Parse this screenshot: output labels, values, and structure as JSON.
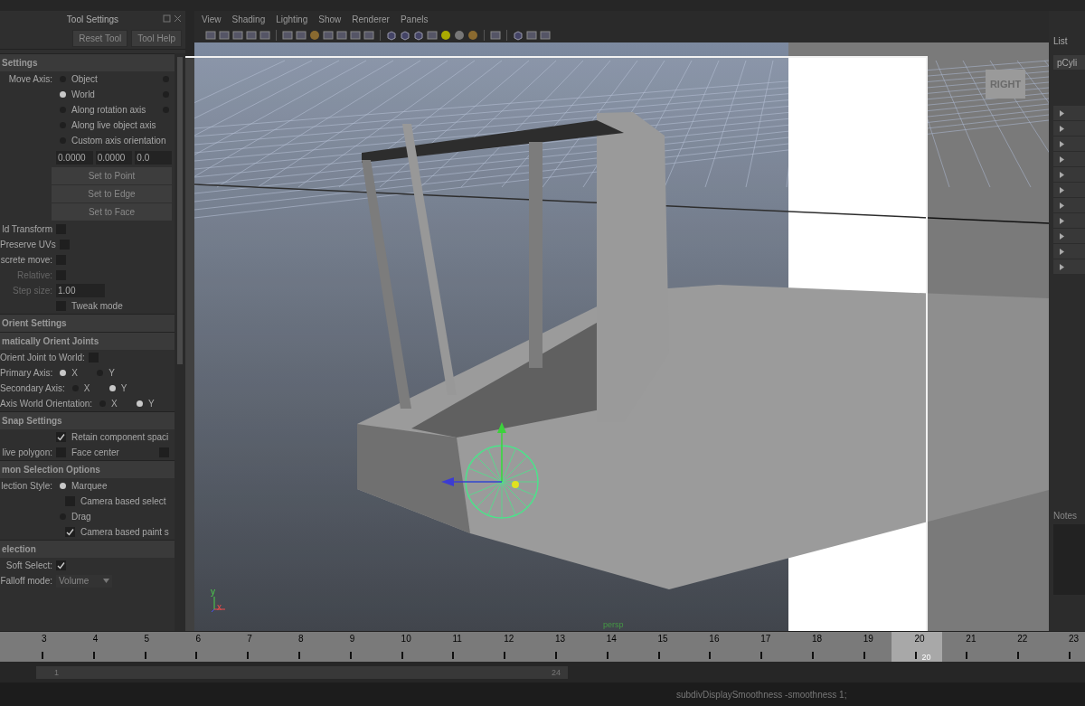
{
  "tool_settings": {
    "title": "Tool Settings",
    "buttons": [
      "Reset Tool",
      "Tool Help"
    ],
    "rows": [
      {
        "kind": "header",
        "text": "Settings"
      },
      {
        "kind": "radio",
        "label": "Move Axis:",
        "option": "Object",
        "selected": false,
        "second": {
          "selected": false
        }
      },
      {
        "kind": "radio",
        "option": "World",
        "selected": true,
        "second": {
          "selected": false
        }
      },
      {
        "kind": "radio",
        "option": "Along rotation axis",
        "selected": false,
        "second": {
          "selected": false
        }
      },
      {
        "kind": "radio",
        "option": "Along live object axis",
        "selected": false
      },
      {
        "kind": "radio",
        "option": "Custom axis orientation",
        "selected": false
      },
      {
        "kind": "fields",
        "values": [
          "0.0000",
          "0.0000",
          "0.0"
        ]
      },
      {
        "kind": "button",
        "text": "Set to Point"
      },
      {
        "kind": "button",
        "text": "Set to Edge"
      },
      {
        "kind": "button",
        "text": "Set to Face"
      },
      {
        "kind": "check",
        "label": "ld Transform",
        "checked": false,
        "disabled": false
      },
      {
        "kind": "check",
        "label": "Preserve UVs",
        "checked": false,
        "disabled": false
      },
      {
        "kind": "check",
        "label": "screte move:",
        "checked": false,
        "disabled": false
      },
      {
        "kind": "check",
        "label": "Relative:",
        "checked": false,
        "disabled": true
      },
      {
        "kind": "field",
        "label": "Step size:",
        "value": "1.00",
        "disabled": true
      },
      {
        "kind": "check",
        "option": "Tweak mode",
        "checked": false,
        "disabled": false
      },
      {
        "kind": "header",
        "text": "Orient Settings"
      },
      {
        "kind": "header",
        "text": "matically Orient Joints"
      },
      {
        "kind": "check",
        "label": "Orient Joint to World:",
        "checked": false,
        "disabled": false
      },
      {
        "kind": "axis",
        "label": "Primary Axis:",
        "options": [
          {
            "text": "X",
            "selected": true
          },
          {
            "text": "Y",
            "selected": false
          }
        ]
      },
      {
        "kind": "axis",
        "label": "Secondary Axis:",
        "options": [
          {
            "text": "X",
            "selected": false
          },
          {
            "text": "Y",
            "selected": true
          }
        ]
      },
      {
        "kind": "axis",
        "label": "Axis World Orientation:",
        "options": [
          {
            "text": "X",
            "selected": false
          },
          {
            "text": "Y",
            "selected": true
          }
        ]
      },
      {
        "kind": "header",
        "text": "Snap Settings"
      },
      {
        "kind": "check",
        "option": "Retain component spaci",
        "checked": true,
        "disabled": false
      },
      {
        "kind": "check",
        "label": "live polygon:",
        "option": "Face center",
        "checked": false,
        "disabled": false,
        "second": {
          "checked": false
        }
      },
      {
        "kind": "header",
        "text": "mon Selection Options"
      },
      {
        "kind": "radio",
        "label": "lection Style:",
        "option": "Marquee",
        "selected": true
      },
      {
        "kind": "subcheck",
        "option": "Camera based select",
        "checked": false
      },
      {
        "kind": "radio",
        "option": "Drag",
        "selected": false
      },
      {
        "kind": "subcheck",
        "option": "Camera based paint s",
        "checked": true
      },
      {
        "kind": "header",
        "text": "election"
      },
      {
        "kind": "check",
        "label": "Soft Select:",
        "checked": true,
        "disabled": false
      },
      {
        "kind": "dropdown",
        "label": "Falloff mode:",
        "value": "Volume"
      }
    ]
  },
  "viewport": {
    "menus": [
      "View",
      "Shading",
      "Lighting",
      "Show",
      "Renderer",
      "Panels"
    ],
    "view_cube": "RIGHT",
    "axis_labels": [
      "y",
      "x"
    ],
    "camera": "persp"
  },
  "right_panel": {
    "title": "List",
    "field": "pCyli",
    "frames": [
      {
        "expanded": false
      },
      {
        "expanded": false
      },
      {
        "expanded": false
      },
      {
        "expanded": false
      },
      {
        "expanded": false
      },
      {
        "expanded": false
      },
      {
        "expanded": false
      },
      {
        "expanded": false
      },
      {
        "expanded": false
      },
      {
        "expanded": false
      },
      {
        "expanded": false
      }
    ],
    "notes": "Notes"
  },
  "timeline": {
    "frames": [
      {
        "label": "3",
        "selected": false
      },
      {
        "label": "4",
        "selected": false
      },
      {
        "label": "5",
        "selected": false
      },
      {
        "label": "6",
        "selected": false
      },
      {
        "label": "7",
        "selected": false
      },
      {
        "label": "8",
        "selected": false
      },
      {
        "label": "9",
        "selected": false
      },
      {
        "label": "10",
        "selected": false
      },
      {
        "label": "11",
        "selected": false
      },
      {
        "label": "12",
        "selected": false
      },
      {
        "label": "13",
        "selected": false
      },
      {
        "label": "14",
        "selected": false
      },
      {
        "label": "15",
        "selected": false
      },
      {
        "label": "16",
        "selected": false
      },
      {
        "label": "17",
        "selected": false
      },
      {
        "label": "18",
        "selected": false
      },
      {
        "label": "19",
        "selected": false
      },
      {
        "label": "20",
        "selected": true
      },
      {
        "label": "21",
        "selected": false
      },
      {
        "label": "22",
        "selected": false
      },
      {
        "label": "23",
        "selected": false
      }
    ],
    "current_frame": "20"
  },
  "range": {
    "start": "1",
    "end": "24"
  },
  "command_line": {
    "text": "subdivDisplaySmoothness -smoothness 1;"
  }
}
